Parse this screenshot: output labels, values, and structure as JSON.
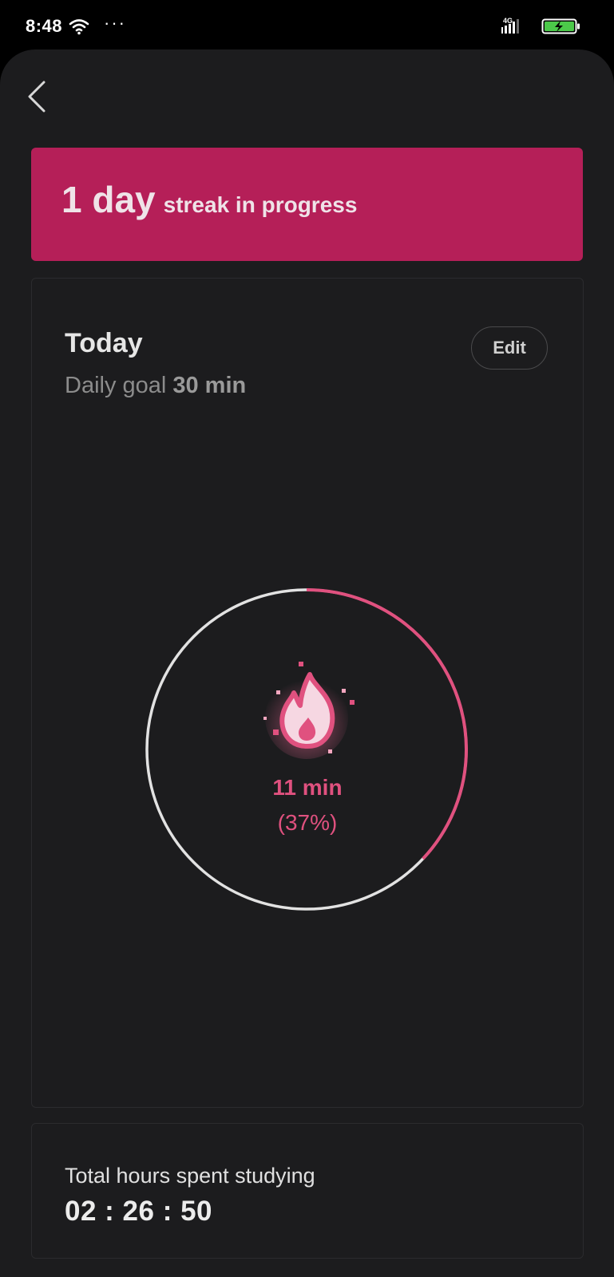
{
  "status_bar": {
    "time": "8:48",
    "dots": "···",
    "network": "4G",
    "wifi_icon": "wifi-icon",
    "signal_icon": "signal-icon",
    "battery_icon": "battery-charging-icon"
  },
  "nav": {
    "back_icon": "chevron-left-icon"
  },
  "streak": {
    "count": "1 day",
    "suffix": "streak in progress",
    "color": "#b51f58"
  },
  "today": {
    "title": "Today",
    "goal_label": "Daily goal",
    "goal_value": "30 min",
    "edit_label": "Edit",
    "progress_minutes": "11 min",
    "progress_percent": "(37%)",
    "progress_fraction": 0.37,
    "accent_color": "#e0517f",
    "icon": "flame-icon"
  },
  "total": {
    "label": "Total hours spent studying",
    "value": "02 : 26 : 50"
  }
}
